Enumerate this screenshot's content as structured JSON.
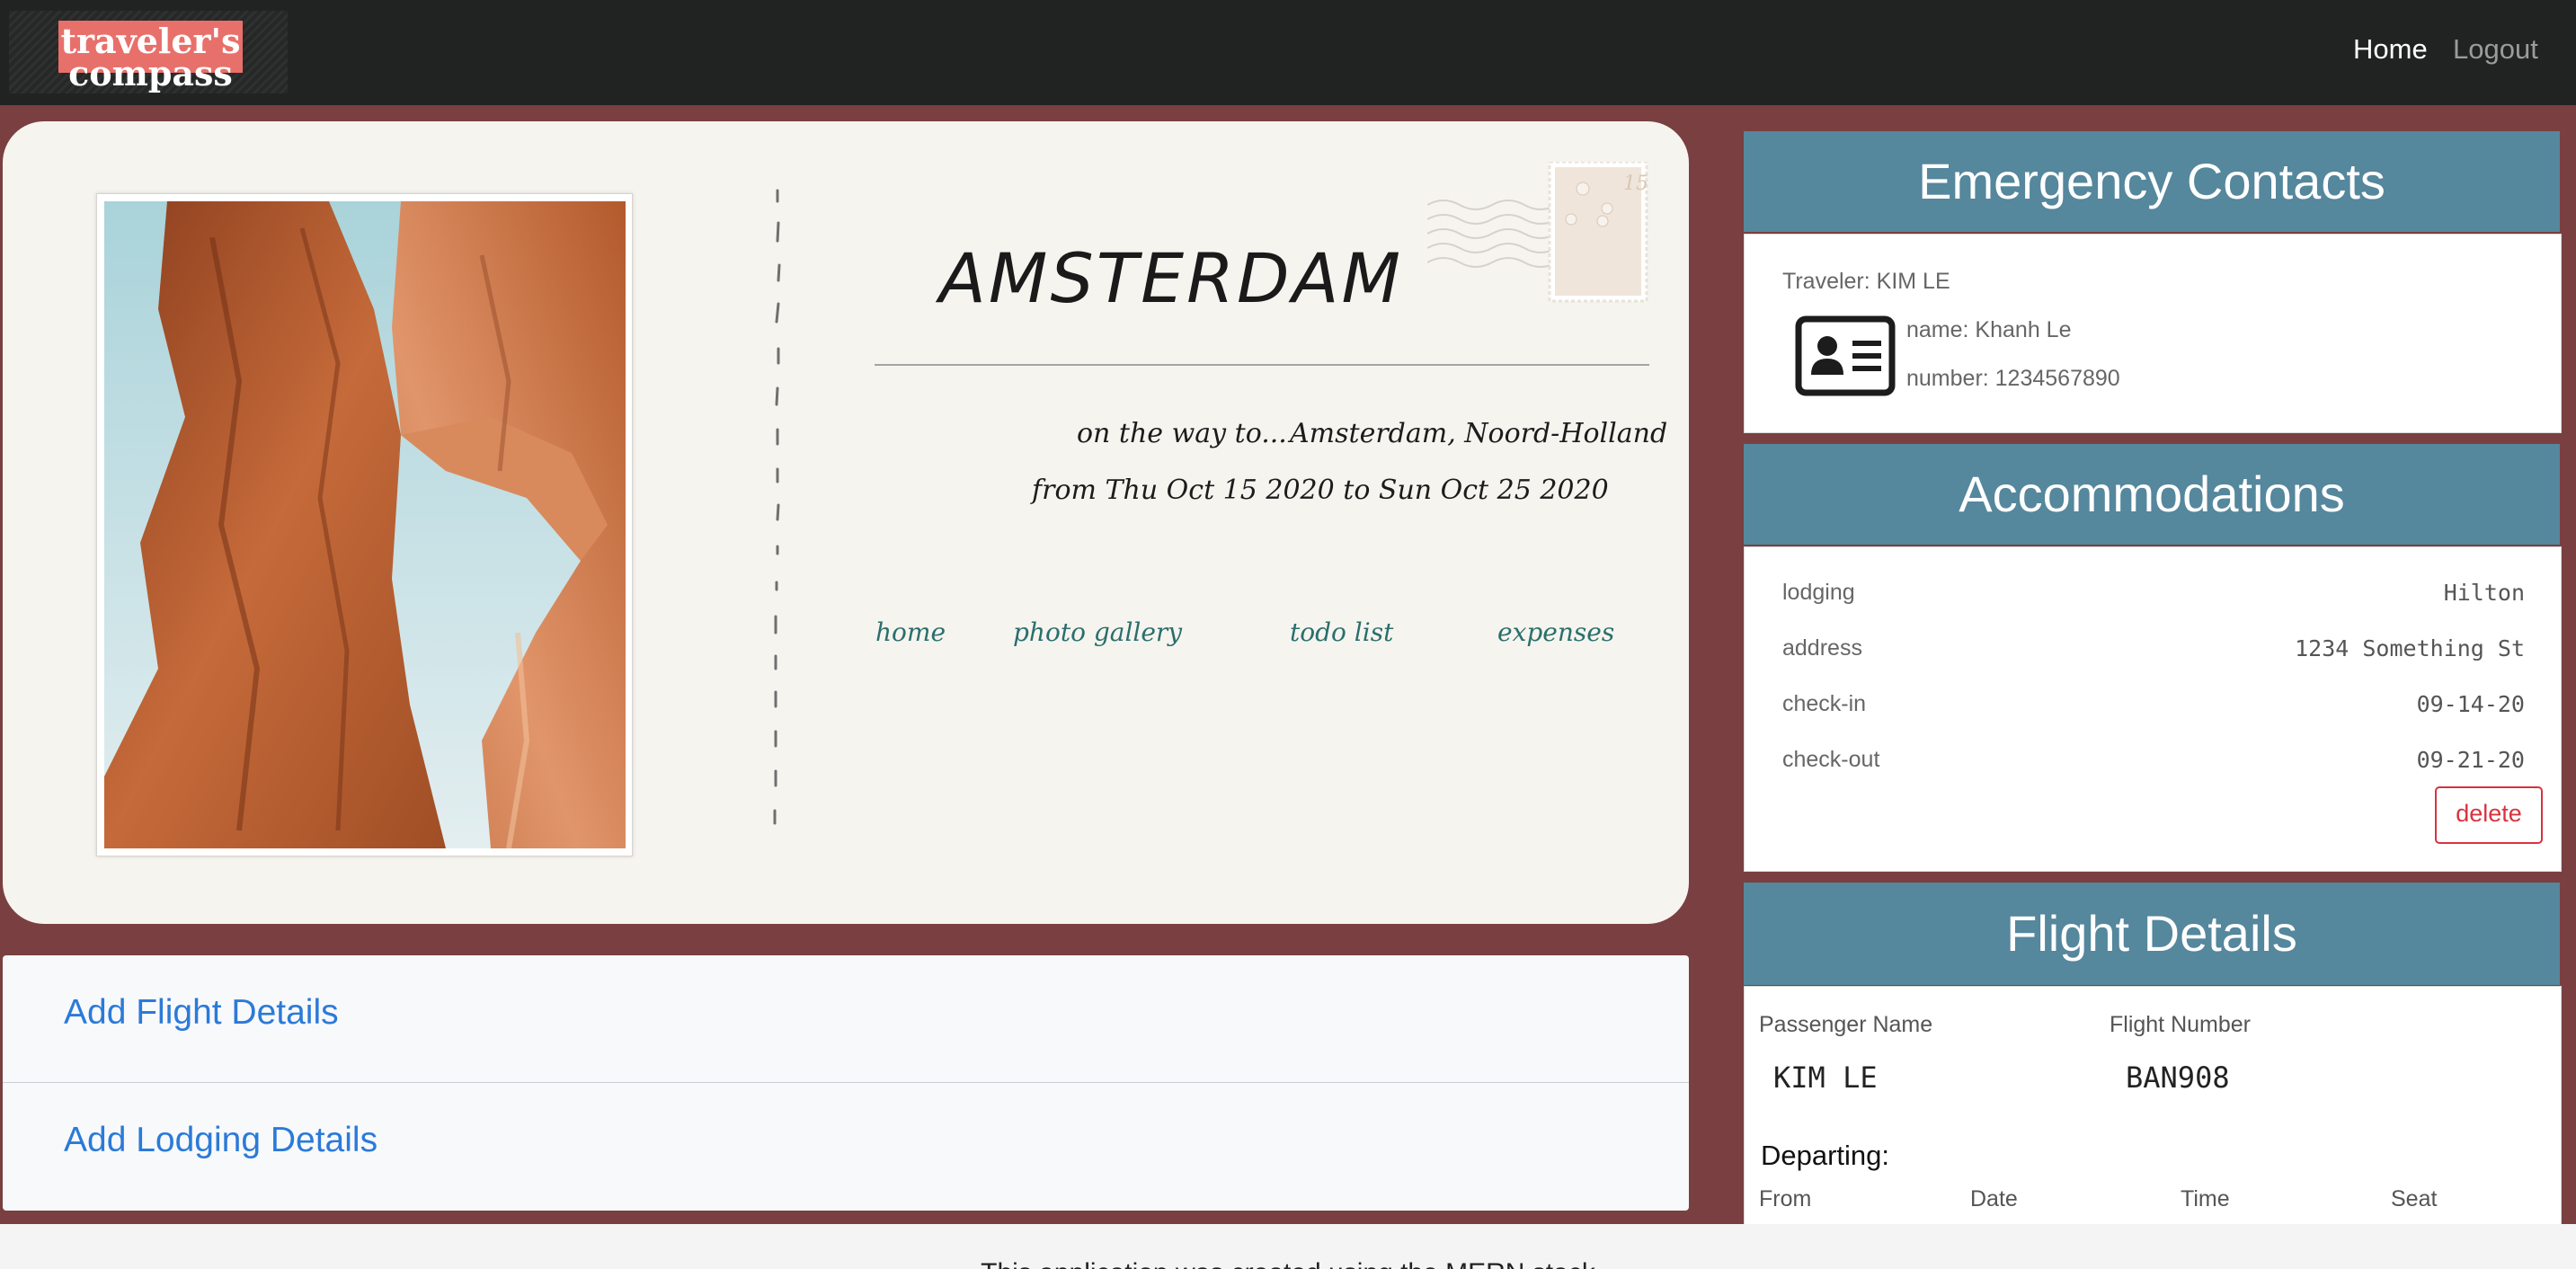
{
  "navbar": {
    "logo_line1": "traveler's",
    "logo_line2": "compass",
    "home": "Home",
    "logout": "Logout"
  },
  "postcard": {
    "city": "AMSTERDAM",
    "on_the_way": "on the way to...",
    "destination": "Amsterdam, Noord-Holland",
    "dates": "from Thu Oct 15 2020 to Sun Oct 25 2020",
    "stamp_value": "15",
    "links": [
      "home",
      "photo gallery",
      "todo list",
      "expenses"
    ]
  },
  "add_panels": {
    "flight": "Add Flight Details",
    "lodging": "Add Lodging Details"
  },
  "emergency": {
    "title": "Emergency Contacts",
    "traveler": "Traveler: KIM LE",
    "name": "name: Khanh Le",
    "number": "number: 1234567890"
  },
  "accommodations": {
    "title": "Accommodations",
    "rows": [
      {
        "label": "lodging",
        "value": "Hilton"
      },
      {
        "label": "address",
        "value": "1234 Something St"
      },
      {
        "label": "check-in",
        "value": "09-14-20"
      },
      {
        "label": "check-out",
        "value": "09-21-20"
      }
    ],
    "delete": "delete"
  },
  "flight": {
    "title": "Flight Details",
    "passenger_label": "Passenger Name",
    "passenger": "KIM LE",
    "number_label": "Flight Number",
    "number": "BAN908",
    "departing": "Departing:",
    "cols": [
      "From",
      "Date",
      "Time",
      "Seat"
    ]
  },
  "footer": {
    "text": "This application was created using the MERN stack"
  },
  "colors": {
    "page_bg": "#7a3f40",
    "navbar": "#212222",
    "logo_bg": "#e8706b",
    "card_header": "#55879d",
    "link_blue": "#2b7ad8",
    "postcard_link": "#2a6f6c",
    "delete_red": "#d8333f"
  }
}
